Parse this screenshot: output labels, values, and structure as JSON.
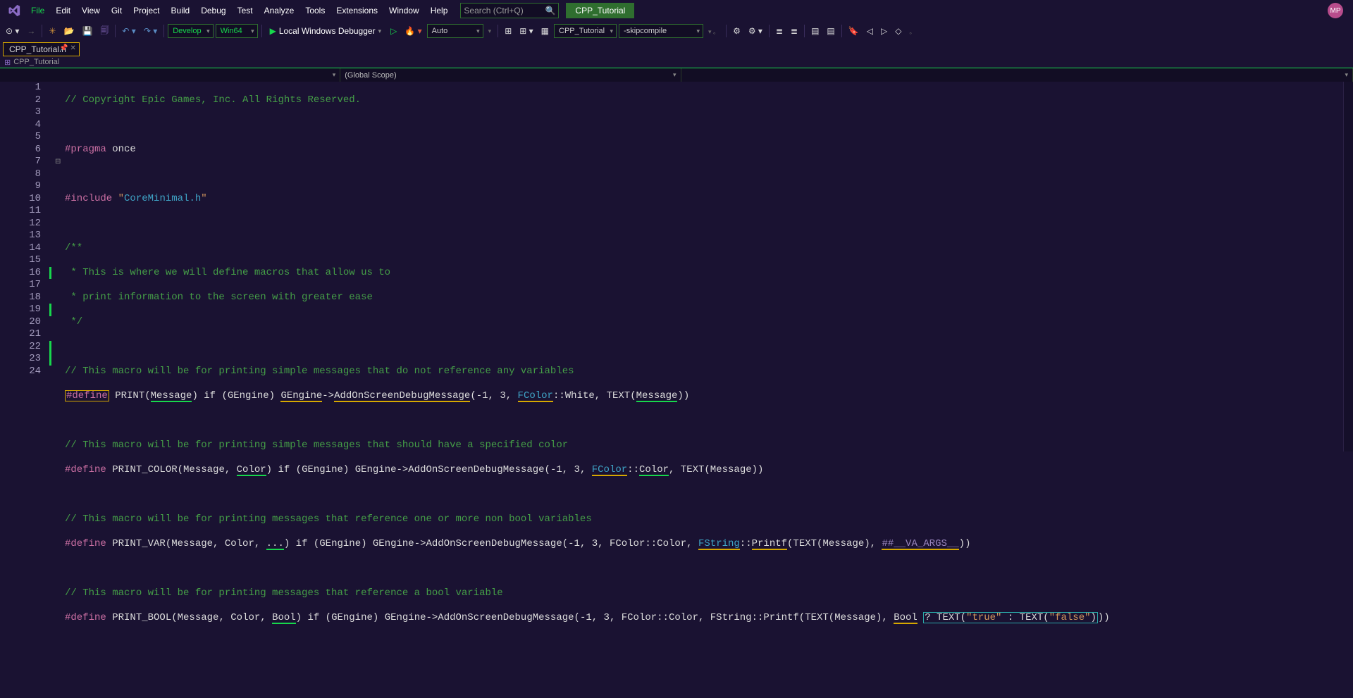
{
  "menubar": {
    "items": [
      "File",
      "Edit",
      "View",
      "Git",
      "Project",
      "Build",
      "Debug",
      "Test",
      "Analyze",
      "Tools",
      "Extensions",
      "Window",
      "Help"
    ]
  },
  "search": {
    "placeholder": "Search (Ctrl+Q)"
  },
  "project_badge": "CPP_Tutorial",
  "avatar_initials": "MP",
  "toolbar": {
    "config": "Develop",
    "platform": "Win64",
    "debug_label": "Local Windows Debugger",
    "build_mode": "Auto",
    "target": "CPP_Tutorial",
    "extra_arg": "-skipcompile"
  },
  "file_tab": {
    "name": "CPP_Tutorial.h"
  },
  "project_bar": {
    "name": "CPP_Tutorial"
  },
  "scope": {
    "col2": "(Global Scope)"
  },
  "code": {
    "lines": [
      {
        "n": 1
      },
      {
        "n": 2
      },
      {
        "n": 3
      },
      {
        "n": 4
      },
      {
        "n": 5
      },
      {
        "n": 6
      },
      {
        "n": 7
      },
      {
        "n": 8
      },
      {
        "n": 9
      },
      {
        "n": 10
      },
      {
        "n": 11
      },
      {
        "n": 12
      },
      {
        "n": 13
      },
      {
        "n": 14
      },
      {
        "n": 15
      },
      {
        "n": 16
      },
      {
        "n": 17
      },
      {
        "n": 18
      },
      {
        "n": 19
      },
      {
        "n": 20
      },
      {
        "n": 21
      },
      {
        "n": 22
      },
      {
        "n": 23
      },
      {
        "n": 24
      }
    ],
    "l1_comment": "// Copyright Epic Games, Inc. All Rights Reserved.",
    "l3_pragma": "#pragma",
    "l3_once": " once",
    "l5_include": "#include ",
    "l5_open_q": "\"",
    "l5_header": "CoreMinimal.h",
    "l5_close_q": "\"",
    "l7_doc": "/**",
    "l8_doc": " * This is where we will define macros that allow us to",
    "l9_doc": " * print information to the screen with greater ease",
    "l10_doc": " */",
    "l12_c": "// This macro will be for printing simple messages that do not reference any variables",
    "l13_define": "#define",
    "l13_print": " PRINT(",
    "l13_msg": "Message",
    "l13_mid1": ") if (GEngine) ",
    "l13_gengine": "GEngine",
    "l13_arrow": "->",
    "l13_addmsg": "AddOnScreenDebugMessage",
    "l13_args1": "(-1, 3, ",
    "l13_fcolor": "FColor",
    "l13_colcol": "::",
    "l13_white": "White, TEXT(",
    "l13_msg2": "Message",
    "l13_end": "))",
    "l15_c": "// This macro will be for printing simple messages that should have a specified color",
    "l16_define": "#define",
    "l16_name": " PRINT_COLOR(Message, ",
    "l16_color": "Color",
    "l16_mid": ") if (GEngine) GEngine->AddOnScreenDebugMessage(-1, 3, ",
    "l16_fcolor": "FColor",
    "l16_colcol": "::",
    "l16_color2": "Color",
    "l16_end": ", TEXT(Message))",
    "l18_c": "// This macro will be for printing messages that reference one or more non bool variables",
    "l19_define": "#define",
    "l19_name": " PRINT_VAR(Message, Color, ",
    "l19_dots": "...",
    "l19_mid": ") if (GEngine) GEngine->AddOnScreenDebugMessage(-1, 3, FColor::Color, ",
    "l19_fstring": "FString",
    "l19_colcol": "::",
    "l19_printf": "Printf",
    "l19_mid2": "(TEXT(Message), ",
    "l19_va": "##__VA_ARGS__",
    "l19_end": "))",
    "l21_c": "// This macro will be for printing messages that reference a bool variable",
    "l22_define": "#define",
    "l22_name": " PRINT_BOOL(Message, Color, ",
    "l22_bool": "Bool",
    "l22_mid": ") if (GEngine) GEngine->AddOnScreenDebugMessage(-1, 3, FColor::Color, FString::Printf(TEXT(Message), ",
    "l22_bool2": "Bool",
    "l22_sp": " ",
    "l22_tern1": "? TEXT(",
    "l22_true": "\"true\"",
    "l22_tern2": " : TEXT(",
    "l22_false": "\"false\"",
    "l22_tern3": ")",
    "l22_end": "))"
  }
}
